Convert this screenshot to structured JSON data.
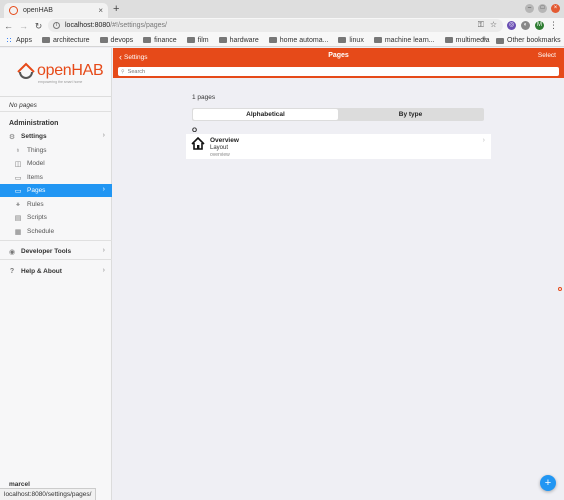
{
  "browser": {
    "tab_title": "openHAB",
    "tab_close": "×",
    "new_tab": "+",
    "url_host": "localhost:8080",
    "url_path": "/#!/settings/pages/",
    "bookmarks": [
      {
        "label": "Apps",
        "icon": "apps-grid-icon"
      },
      {
        "label": "architecture",
        "icon": "folder-icon"
      },
      {
        "label": "devops",
        "icon": "folder-icon"
      },
      {
        "label": "finance",
        "icon": "folder-icon"
      },
      {
        "label": "film",
        "icon": "folder-icon"
      },
      {
        "label": "hardware",
        "icon": "folder-icon"
      },
      {
        "label": "home automa...",
        "icon": "folder-icon"
      },
      {
        "label": "linux",
        "icon": "folder-icon"
      },
      {
        "label": "machine learn...",
        "icon": "folder-icon"
      },
      {
        "label": "multimedia",
        "icon": "folder-icon"
      }
    ],
    "bookmarks_more": "»",
    "other_bookmarks": "Other bookmarks",
    "avatar_letter": "M",
    "status_url": "localhost:8080/settings/pages/"
  },
  "sidebar": {
    "logo_text": "openHAB",
    "logo_tagline": "empowering the smart home",
    "no_pages": "No pages",
    "admin_title": "Administration",
    "items": [
      {
        "label": "Settings",
        "icon": "gear-icon"
      },
      {
        "label": "Things",
        "icon": "lightbulb-icon"
      },
      {
        "label": "Model",
        "icon": "model-icon"
      },
      {
        "label": "Items",
        "icon": "items-icon"
      },
      {
        "label": "Pages",
        "icon": "monitor-icon"
      },
      {
        "label": "Rules",
        "icon": "rules-icon"
      },
      {
        "label": "Scripts",
        "icon": "script-icon"
      },
      {
        "label": "Schedule",
        "icon": "calendar-icon"
      }
    ],
    "developer_tools": "Developer Tools",
    "help_about": "Help & About",
    "user_name": "marcel"
  },
  "header": {
    "back_label": "Settings",
    "title": "Pages",
    "select_label": "Select",
    "search_placeholder": "Search"
  },
  "main": {
    "count_label": "1 pages",
    "tabs": [
      {
        "label": "Alphabetical",
        "active": true
      },
      {
        "label": "By type",
        "active": false
      }
    ],
    "group_letter": "O",
    "pages": [
      {
        "title": "Overview",
        "type": "Layout",
        "uid": "overview",
        "icon": "house-icon"
      }
    ]
  },
  "fab_label": "+",
  "colors": {
    "brand": "#e64a19",
    "active": "#2196f3"
  }
}
